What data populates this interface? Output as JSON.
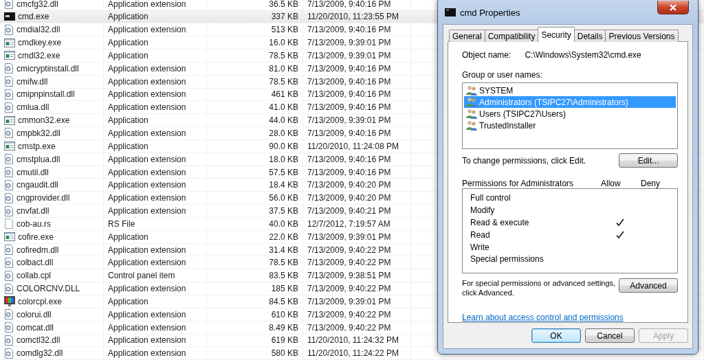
{
  "file_list": {
    "rows": [
      {
        "name": "cmcfg32.dll",
        "type": "Application extension",
        "size": "36.5 KB",
        "modified": "7/13/2009, 9:40:16 PM",
        "kind": "dll",
        "selected": false
      },
      {
        "name": "cmd.exe",
        "type": "Application",
        "size": "337 KB",
        "modified": "11/20/2010, 11:23:55 PM",
        "kind": "console",
        "selected": true
      },
      {
        "name": "cmdial32.dll",
        "type": "Application extension",
        "size": "513 KB",
        "modified": "7/13/2009, 9:40:16 PM",
        "kind": "dll",
        "selected": false
      },
      {
        "name": "cmdkey.exe",
        "type": "Application",
        "size": "16.0 KB",
        "modified": "7/13/2009, 9:39:01 PM",
        "kind": "exe",
        "selected": false
      },
      {
        "name": "cmdl32.exe",
        "type": "Application",
        "size": "78.5 KB",
        "modified": "7/13/2009, 9:39:01 PM",
        "kind": "exe",
        "selected": false
      },
      {
        "name": "cmicryptinstall.dll",
        "type": "Application extension",
        "size": "81.0 KB",
        "modified": "7/13/2009, 9:40:16 PM",
        "kind": "dll",
        "selected": false
      },
      {
        "name": "cmifw.dll",
        "type": "Application extension",
        "size": "78.5 KB",
        "modified": "7/13/2009, 9:40:16 PM",
        "kind": "dll",
        "selected": false
      },
      {
        "name": "cmipnpinstall.dll",
        "type": "Application extension",
        "size": "461 KB",
        "modified": "7/13/2009, 9:40:16 PM",
        "kind": "dll",
        "selected": false
      },
      {
        "name": "cmlua.dll",
        "type": "Application extension",
        "size": "41.0 KB",
        "modified": "7/13/2009, 9:40:16 PM",
        "kind": "dll",
        "selected": false
      },
      {
        "name": "cmmon32.exe",
        "type": "Application",
        "size": "44.0 KB",
        "modified": "7/13/2009, 9:39:01 PM",
        "kind": "exe",
        "selected": false
      },
      {
        "name": "cmpbk32.dll",
        "type": "Application extension",
        "size": "28.0 KB",
        "modified": "7/13/2009, 9:40:16 PM",
        "kind": "dll",
        "selected": false
      },
      {
        "name": "cmstp.exe",
        "type": "Application",
        "size": "90.0 KB",
        "modified": "11/20/2010, 11:24:08 PM",
        "kind": "exe",
        "selected": false
      },
      {
        "name": "cmstplua.dll",
        "type": "Application extension",
        "size": "18.0 KB",
        "modified": "7/13/2009, 9:40:16 PM",
        "kind": "dll",
        "selected": false
      },
      {
        "name": "cmutil.dll",
        "type": "Application extension",
        "size": "57.5 KB",
        "modified": "7/13/2009, 9:40:16 PM",
        "kind": "dll",
        "selected": false
      },
      {
        "name": "cngaudit.dll",
        "type": "Application extension",
        "size": "18.4 KB",
        "modified": "7/13/2009, 9:40:20 PM",
        "kind": "dll",
        "selected": false
      },
      {
        "name": "cngprovider.dll",
        "type": "Application extension",
        "size": "56.0 KB",
        "modified": "7/13/2009, 9:40:20 PM",
        "kind": "dll",
        "selected": false
      },
      {
        "name": "cnvfat.dll",
        "type": "Application extension",
        "size": "37.5 KB",
        "modified": "7/13/2009, 9:40:21 PM",
        "kind": "dll",
        "selected": false
      },
      {
        "name": "cob-au.rs",
        "type": "RS File",
        "size": "40.0 KB",
        "modified": "12/7/2012, 7:19:57 AM",
        "kind": "blank",
        "selected": false
      },
      {
        "name": "cofire.exe",
        "type": "Application",
        "size": "22.0 KB",
        "modified": "7/13/2009, 9:39:01 PM",
        "kind": "exe",
        "selected": false
      },
      {
        "name": "cofiredm.dll",
        "type": "Application extension",
        "size": "31.4 KB",
        "modified": "7/13/2009, 9:40:22 PM",
        "kind": "dll",
        "selected": false
      },
      {
        "name": "colbact.dll",
        "type": "Application extension",
        "size": "78.5 KB",
        "modified": "7/13/2009, 9:40:22 PM",
        "kind": "dll",
        "selected": false
      },
      {
        "name": "collab.cpl",
        "type": "Control panel item",
        "size": "83.5 KB",
        "modified": "7/13/2009, 9:38:51 PM",
        "kind": "dll",
        "selected": false
      },
      {
        "name": "COLORCNV.DLL",
        "type": "Application extension",
        "size": "185 KB",
        "modified": "7/13/2009, 9:40:22 PM",
        "kind": "dll",
        "selected": false
      },
      {
        "name": "colorcpl.exe",
        "type": "Application",
        "size": "84.5 KB",
        "modified": "7/13/2009, 9:39:01 PM",
        "kind": "monitor",
        "selected": false
      },
      {
        "name": "colorui.dll",
        "type": "Application extension",
        "size": "610 KB",
        "modified": "7/13/2009, 9:40:22 PM",
        "kind": "dll",
        "selected": false
      },
      {
        "name": "comcat.dll",
        "type": "Application extension",
        "size": "8.49 KB",
        "modified": "7/13/2009, 9:40:22 PM",
        "kind": "dll",
        "selected": false
      },
      {
        "name": "comctl32.dll",
        "type": "Application extension",
        "size": "619 KB",
        "modified": "11/20/2010, 11:24:32 PM",
        "kind": "dll",
        "selected": false
      },
      {
        "name": "comdlg32.dll",
        "type": "Application extension",
        "size": "580 KB",
        "modified": "11/20/2010, 11:24:22 PM",
        "kind": "dll",
        "selected": false
      }
    ]
  },
  "dialog": {
    "title": "cmd Properties",
    "tabs": [
      {
        "label": "General",
        "selected": false
      },
      {
        "label": "Compatibility",
        "selected": false
      },
      {
        "label": "Security",
        "selected": true
      },
      {
        "label": "Details",
        "selected": false
      },
      {
        "label": "Previous Versions",
        "selected": false
      }
    ],
    "object_name_label": "Object name:",
    "object_name": "C:\\Windows\\System32\\cmd.exe",
    "group_label": "Group or user names:",
    "users": [
      {
        "name": "SYSTEM",
        "selected": false
      },
      {
        "name": "Administrators (TSIPC27\\Administrators)",
        "selected": true
      },
      {
        "name": "Users (TSIPC27\\Users)",
        "selected": false
      },
      {
        "name": "TrustedInstaller",
        "selected": false
      }
    ],
    "change_hint": "To change permissions, click Edit.",
    "edit_button": "Edit...",
    "permissions_label": "Permissions for Administrators",
    "allow_header": "Allow",
    "deny_header": "Deny",
    "permissions": [
      {
        "name": "Full control",
        "allow": false,
        "deny": false
      },
      {
        "name": "Modify",
        "allow": false,
        "deny": false
      },
      {
        "name": "Read & execute",
        "allow": true,
        "deny": false
      },
      {
        "name": "Read",
        "allow": true,
        "deny": false
      },
      {
        "name": "Write",
        "allow": false,
        "deny": false
      },
      {
        "name": "Special permissions",
        "allow": false,
        "deny": false
      }
    ],
    "advanced_hint": "For special permissions or advanced settings,\nclick Advanced.",
    "advanced_button": "Advanced",
    "learn_link": "Learn about access control and permissions",
    "buttons": [
      {
        "label": "OK",
        "kind": "default",
        "disabled": false
      },
      {
        "label": "Cancel",
        "kind": "normal",
        "disabled": false
      },
      {
        "label": "Apply",
        "kind": "normal",
        "disabled": true
      }
    ]
  }
}
